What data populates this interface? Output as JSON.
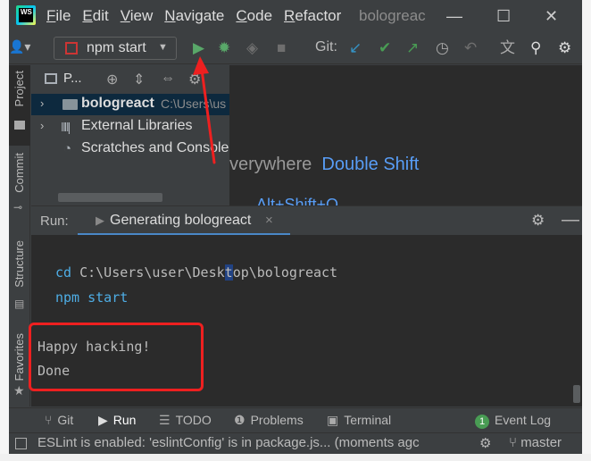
{
  "menu": {
    "items": [
      {
        "label": "File",
        "mnemonic": "F",
        "rest": "ile"
      },
      {
        "label": "Edit",
        "mnemonic": "E",
        "rest": "dit"
      },
      {
        "label": "View",
        "mnemonic": "V",
        "rest": "iew"
      },
      {
        "label": "Navigate",
        "mnemonic": "N",
        "rest": "avigate"
      },
      {
        "label": "Code",
        "mnemonic": "C",
        "rest": "ode"
      },
      {
        "label": "Refactor",
        "mnemonic": "R",
        "rest": "efactor"
      }
    ],
    "project_title": "bologreac"
  },
  "toolbar": {
    "run_config_label": "npm start",
    "git_label": "Git:",
    "icons": [
      "user-dropdown-icon",
      "npm-icon",
      "run-icon",
      "debug-icon",
      "coverage-icon",
      "stop-icon",
      "git-update-icon",
      "git-commit-icon",
      "git-push-icon",
      "history-icon",
      "rollback-icon",
      "translate-icon",
      "search-icon",
      "settings-icon"
    ]
  },
  "left_strip": {
    "tabs": [
      "Project",
      "Commit",
      "Structure",
      "Favorites"
    ]
  },
  "project_panel": {
    "header_label": "P...",
    "tree": [
      {
        "name": "bologreact",
        "path": "C:\\Users\\us",
        "selected": true,
        "type": "folder"
      },
      {
        "name": "External Libraries",
        "type": "libraries"
      },
      {
        "name": "Scratches and Consoles",
        "type": "scratches"
      }
    ]
  },
  "editor": {
    "hint_text": "verywhere",
    "hint_key": "Double Shift",
    "hint2_text": "Alt+Shift+O"
  },
  "run_panel": {
    "label": "Run:",
    "tab_name": "Generating bologreact",
    "tab_close": "×"
  },
  "console": {
    "cmd1_prefix": "cd",
    "cmd1_path_a": "C:\\Users\\user\\Desk",
    "cmd1_path_caret": "t",
    "cmd1_path_b": "op\\bologreact",
    "cmd2_prefix": "npm",
    "cmd2_arg": "start",
    "out1": "Happy hacking!",
    "out2": "Done"
  },
  "bottom_tabs": [
    {
      "label": "Git",
      "icon": "branch-icon"
    },
    {
      "label": "Run",
      "icon": "run-icon",
      "active": true
    },
    {
      "label": "TODO",
      "icon": "list-icon"
    },
    {
      "label": "Problems",
      "icon": "info-icon"
    },
    {
      "label": "Terminal",
      "icon": "terminal-icon"
    },
    {
      "label": "Event Log",
      "icon": "event-log-badge-icon",
      "badge": "1"
    }
  ],
  "status": {
    "message": "ESLint is enabled: 'eslintConfig' is in package.js... (moments agc",
    "branch": "master"
  },
  "colors": {
    "ide_bg": "#3c3f41",
    "editor_bg": "#2b2b2b",
    "accent_blue": "#4a88c7",
    "annotation_red": "#ee2020",
    "run_green": "#499c54"
  }
}
